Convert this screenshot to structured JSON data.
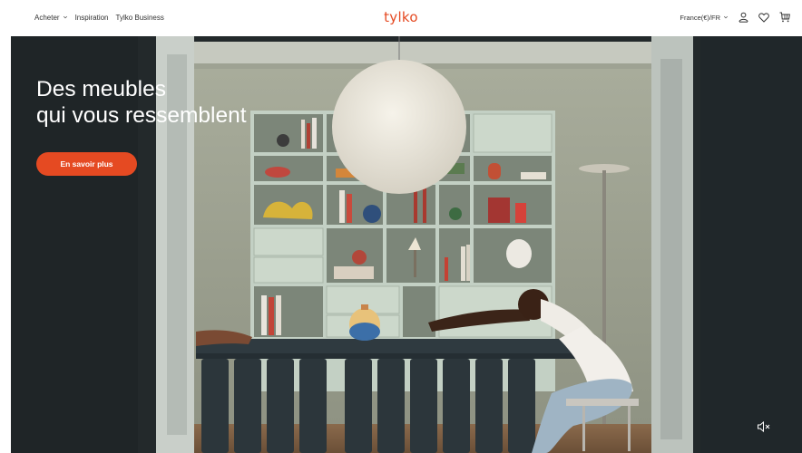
{
  "header": {
    "nav": [
      {
        "label": "Acheter",
        "has_dropdown": true
      },
      {
        "label": "Inspiration",
        "has_dropdown": false
      },
      {
        "label": "Tylko Business",
        "has_dropdown": false
      }
    ],
    "logo_text": "tylko",
    "region_label": "France(€)/FR",
    "icons": [
      "chevron-down-icon",
      "user-icon",
      "heart-icon",
      "cart-icon"
    ]
  },
  "hero": {
    "title_line1": "Des meubles",
    "title_line2": "qui vous ressemblent",
    "cta_label": "En savoir plus",
    "mute_icon": "speaker-muted-icon"
  },
  "colors": {
    "brand": "#e54a22",
    "header_bg": "#ffffff",
    "hero_text": "#ffffff"
  }
}
